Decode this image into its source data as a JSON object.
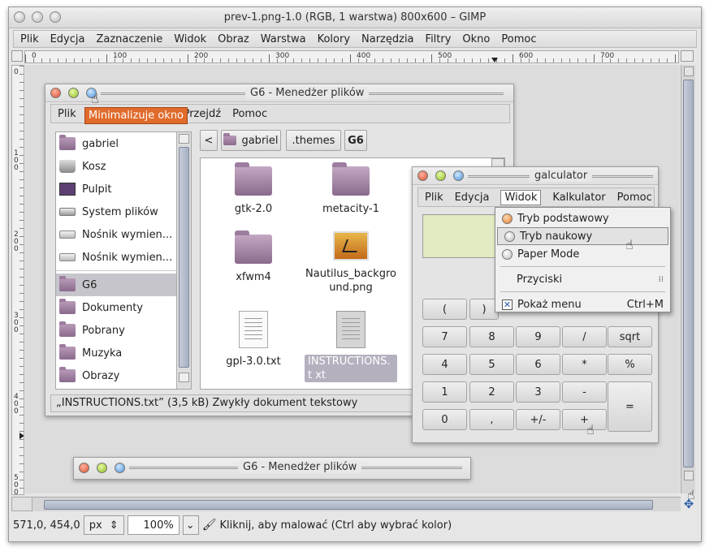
{
  "gimp": {
    "title": "prev-1.png-1.0 (RGB, 1 warstwa) 800x600 – GIMP",
    "menu": [
      "Plik",
      "Edycja",
      "Zaznaczenie",
      "Widok",
      "Obraz",
      "Warstwa",
      "Kolory",
      "Narzędzia",
      "Filtry",
      "Okno",
      "Pomoc"
    ],
    "ruler_h": [
      "0",
      "100",
      "200",
      "300",
      "400",
      "500",
      "600",
      "700"
    ],
    "ruler_v": [
      "0",
      "100",
      "200",
      "300",
      "400",
      "500"
    ],
    "status": {
      "coords": "571,0, 454,0",
      "unit": "px",
      "zoom": "100%",
      "message": "Kliknij, aby malować (Ctrl aby wybrać kolor)"
    }
  },
  "fm": {
    "title": "G6 - Menedżer plików",
    "menu": [
      "Plik",
      "Przejdź",
      "Pomoc"
    ],
    "tooltip": "Minimalizuje okno",
    "sidebar": [
      {
        "label": "gabriel",
        "icon": "home-folder-icon"
      },
      {
        "label": "Kosz",
        "icon": "trash-icon"
      },
      {
        "label": "Pulpit",
        "icon": "desktop-icon"
      },
      {
        "label": "System plików",
        "icon": "drive-icon"
      },
      {
        "label": "Nośnik wymien...",
        "icon": "drive-icon"
      },
      {
        "label": "Nośnik wymien...",
        "icon": "drive-icon"
      },
      {
        "label": "G6",
        "icon": "folder-icon"
      },
      {
        "label": "Dokumenty",
        "icon": "folder-icon"
      },
      {
        "label": "Pobrany",
        "icon": "folder-icon"
      },
      {
        "label": "Muzyka",
        "icon": "folder-icon"
      },
      {
        "label": "Obrazy",
        "icon": "folder-icon"
      }
    ],
    "path": {
      "back": "<",
      "home": "gabriel",
      "themes": ".themes",
      "current": "G6"
    },
    "files": [
      {
        "name": "gtk-2.0",
        "kind": "folder"
      },
      {
        "name": "metacity-1",
        "kind": "folder"
      },
      {
        "name": "xfwm4",
        "kind": "folder"
      },
      {
        "name": "Nautilus_backgro und.png",
        "kind": "image"
      },
      {
        "name": "gpl-3.0.txt",
        "kind": "text"
      },
      {
        "name": "INSTRUCTIONS.t xt",
        "kind": "text"
      }
    ],
    "statusbar": "„INSTRUCTIONS.txt” (3,5 kB) Zwykły dokument tekstowy"
  },
  "fm2": {
    "title": "G6 - Menedżer plików"
  },
  "calc": {
    "title": "galculator",
    "menu": [
      "Plik",
      "Edycja",
      "Widok",
      "Kalkulator",
      "Pomoc"
    ],
    "buttons": [
      [
        "(",
        ")",
        "",
        ""
      ],
      [
        "7",
        "8",
        "9",
        "/",
        "sqrt"
      ],
      [
        "4",
        "5",
        "6",
        "*",
        "%"
      ],
      [
        "1",
        "2",
        "3",
        "-",
        "="
      ],
      [
        "0",
        ",",
        "+/-",
        "+"
      ]
    ],
    "dropdown": {
      "modes": [
        "Tryb podstawowy",
        "Tryb naukowy",
        "Paper Mode"
      ],
      "buttons_item": "Przyciski",
      "show_menu": "Pokaż menu",
      "show_menu_shortcut": "Ctrl+M"
    }
  }
}
